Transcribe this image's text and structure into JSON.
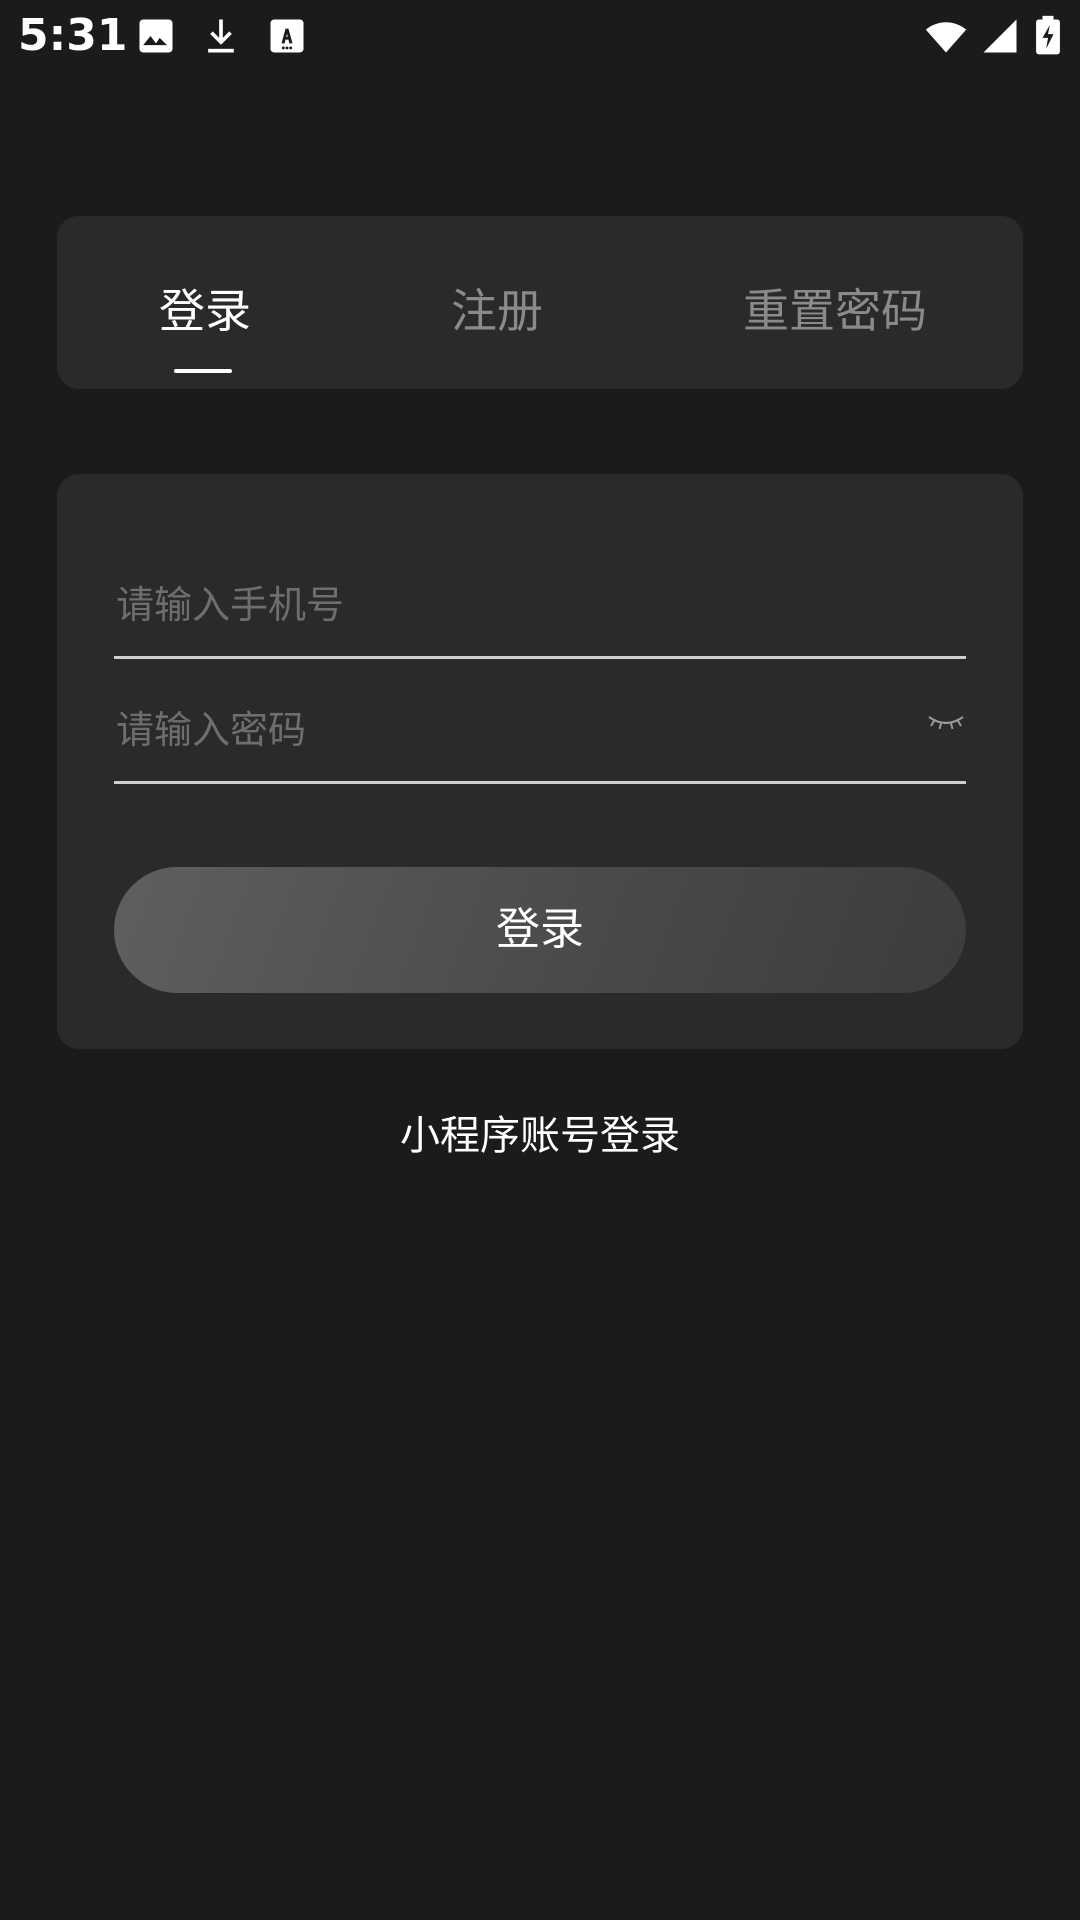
{
  "status_bar": {
    "time": "5:31",
    "icons_left": [
      "image-icon",
      "download-icon",
      "font-download-icon"
    ],
    "icons_right": [
      "wifi-icon",
      "cell-signal-icon",
      "battery-charging-icon"
    ]
  },
  "tabs": [
    {
      "id": "login",
      "label": "登录",
      "active": true
    },
    {
      "id": "register",
      "label": "注册",
      "active": false
    },
    {
      "id": "reset",
      "label": "重置密码",
      "active": false
    }
  ],
  "form": {
    "phone_placeholder": "请输入手机号",
    "phone_value": "",
    "password_placeholder": "请输入密码",
    "password_value": "",
    "password_visibility_icon": "eye-closed-icon",
    "submit_label": "登录"
  },
  "mini_program_login_label": "小程序账号登录",
  "colors": {
    "background": "#1b1b1b",
    "card": "#2a2a2a",
    "text_active": "#ffffff",
    "text_inactive": "#8a8a8a",
    "placeholder": "#6e6e6e",
    "field_line": "#cfcfcf"
  }
}
